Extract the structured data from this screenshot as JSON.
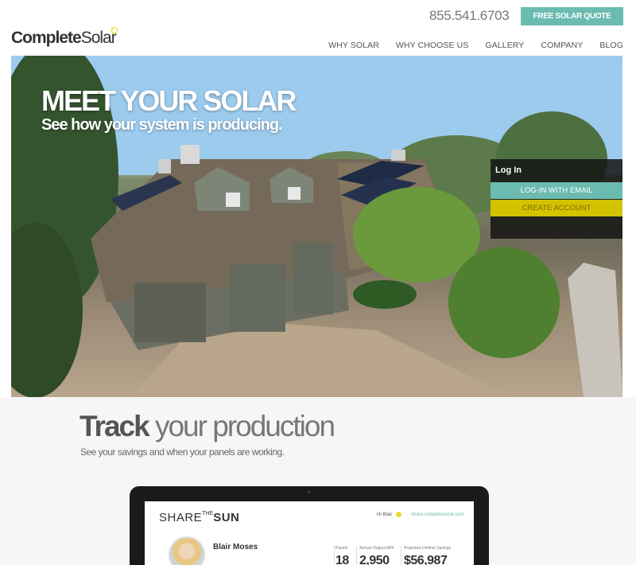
{
  "header": {
    "logo_bold": "Complete",
    "logo_light": "Solar",
    "phone": "855.541.6703",
    "quote_button": "FREE SOLAR QUOTE",
    "nav": [
      "WHY SOLAR",
      "WHY CHOOSE US",
      "GALLERY",
      "COMPANY",
      "BLOG"
    ]
  },
  "hero": {
    "title": "MEET YOUR SOLAR",
    "subtitle": "See how your system is producing.",
    "login": {
      "title": "Log In",
      "email_button": "LOG-IN WITH EMAIL",
      "create_button": "CREATE ACCOUNT"
    }
  },
  "track": {
    "title_bold": "Track",
    "title_rest": " your production",
    "subtitle": "See your savings and when your panels are working."
  },
  "dashboard": {
    "share_a": "SHARE",
    "share_the": "THE",
    "share_sun": "SUN",
    "greeting": "Hi Blair",
    "site": "share.completesolar.com",
    "user_name": "Blair Moses",
    "stats": [
      {
        "label": "Panels",
        "value": "18"
      },
      {
        "label": "Annual Output kWh",
        "value": "2,950"
      },
      {
        "label": "Projected Lifetime Savings",
        "value": "$56,987"
      }
    ]
  },
  "colors": {
    "accent_teal": "#6bbbb0",
    "accent_yellow": "#d2c200"
  }
}
